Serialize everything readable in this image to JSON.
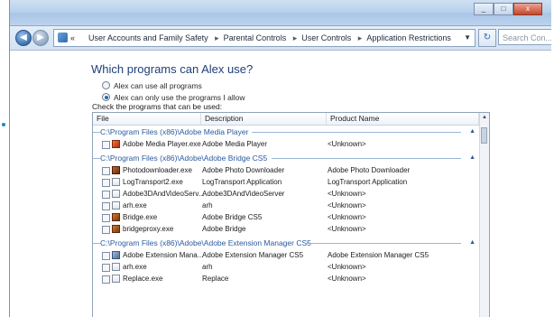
{
  "window": {
    "controls": {
      "minimize": "_",
      "maximize": "□",
      "close": "x"
    }
  },
  "navbar": {
    "back_label": "◀",
    "forward_label": "▶",
    "breadcrumb": [
      "User Accounts and Family Safety",
      "Parental Controls",
      "User Controls",
      "Application Restrictions"
    ],
    "breadcrumb_lead": "«",
    "search_placeholder": "Search Con..."
  },
  "content": {
    "question": "Which programs can Alex use?",
    "options": [
      {
        "label": "Alex can use all programs",
        "selected": false
      },
      {
        "label": "Alex can only use the programs I allow",
        "selected": true
      }
    ],
    "check_label": "Check the programs that can be used:"
  },
  "table": {
    "columns": [
      "File",
      "Description",
      "Product Name"
    ],
    "groups": [
      {
        "path": "C:\\Program Files (x86)\\Adobe Media Player",
        "rows": [
          {
            "icon": "red",
            "file": "Adobe Media Player.exe",
            "description": "Adobe Media Player",
            "product": "<Unknown>"
          }
        ]
      },
      {
        "path": "C:\\Program Files (x86)\\Adobe\\Adobe Bridge CS5",
        "rows": [
          {
            "icon": "photo",
            "file": "Photodownloader.exe",
            "description": "Adobe Photo Downloader",
            "product": "Adobe Photo Downloader"
          },
          {
            "icon": "exe",
            "file": "LogTransport2.exe",
            "description": "LogTransport Application",
            "product": "LogTransport Application"
          },
          {
            "icon": "exe",
            "file": "Adobe3DAndVideoServ...",
            "description": "Adobe3DAndVideoServer",
            "product": "<Unknown>"
          },
          {
            "icon": "exe",
            "file": "arh.exe",
            "description": "arh",
            "product": "<Unknown>"
          },
          {
            "icon": "br",
            "file": "Bridge.exe",
            "description": "Adobe Bridge CS5",
            "product": "<Unknown>"
          },
          {
            "icon": "br",
            "file": "bridgeproxy.exe",
            "description": "Adobe Bridge",
            "product": "<Unknown>"
          }
        ]
      },
      {
        "path": "C:\\Program Files (x86)\\Adobe\\Adobe Extension Manager CS5",
        "rows": [
          {
            "icon": "doc",
            "file": "Adobe Extension Mana...",
            "description": "Adobe Extension Manager CS5",
            "product": "Adobe Extension Manager CS5"
          },
          {
            "icon": "exe",
            "file": "arh.exe",
            "description": "arh",
            "product": "<Unknown>"
          },
          {
            "icon": "exe",
            "file": "Replace.exe",
            "description": "Replace",
            "product": "<Unknown>"
          }
        ]
      }
    ]
  },
  "colors": {
    "accent": "#1f86c9",
    "heading": "#1e3f79",
    "group_text": "#2a5aa0"
  },
  "icons": {
    "back": "back-arrow-icon",
    "forward": "forward-arrow-icon",
    "refresh": "refresh-icon",
    "search": "search-icon",
    "collapse": "collapse-chevron-icon"
  }
}
